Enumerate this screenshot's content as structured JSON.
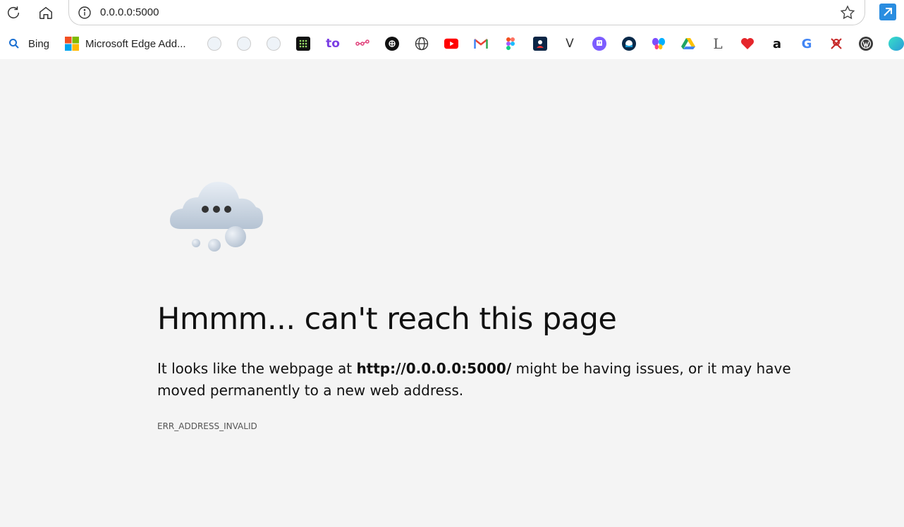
{
  "browser": {
    "address": {
      "url": "0.0.0.0:5000"
    },
    "bookmarks": [
      {
        "label": "Bing",
        "icon": "search-icon"
      },
      {
        "label": "Microsoft Edge Add...",
        "icon": "microsoft-logo-icon"
      }
    ],
    "colors": {
      "accent": "#2a8de0",
      "page_bg": "#f4f4f4"
    }
  },
  "error_page": {
    "title": "Hmmm... can't reach this page",
    "desc_prefix": "It looks like the webpage at ",
    "desc_url": "http://0.0.0.0:5000/",
    "desc_suffix": " might be having issues, or it may have moved permanently to a new web address.",
    "error_code": "ERR_ADDRESS_INVALID"
  }
}
